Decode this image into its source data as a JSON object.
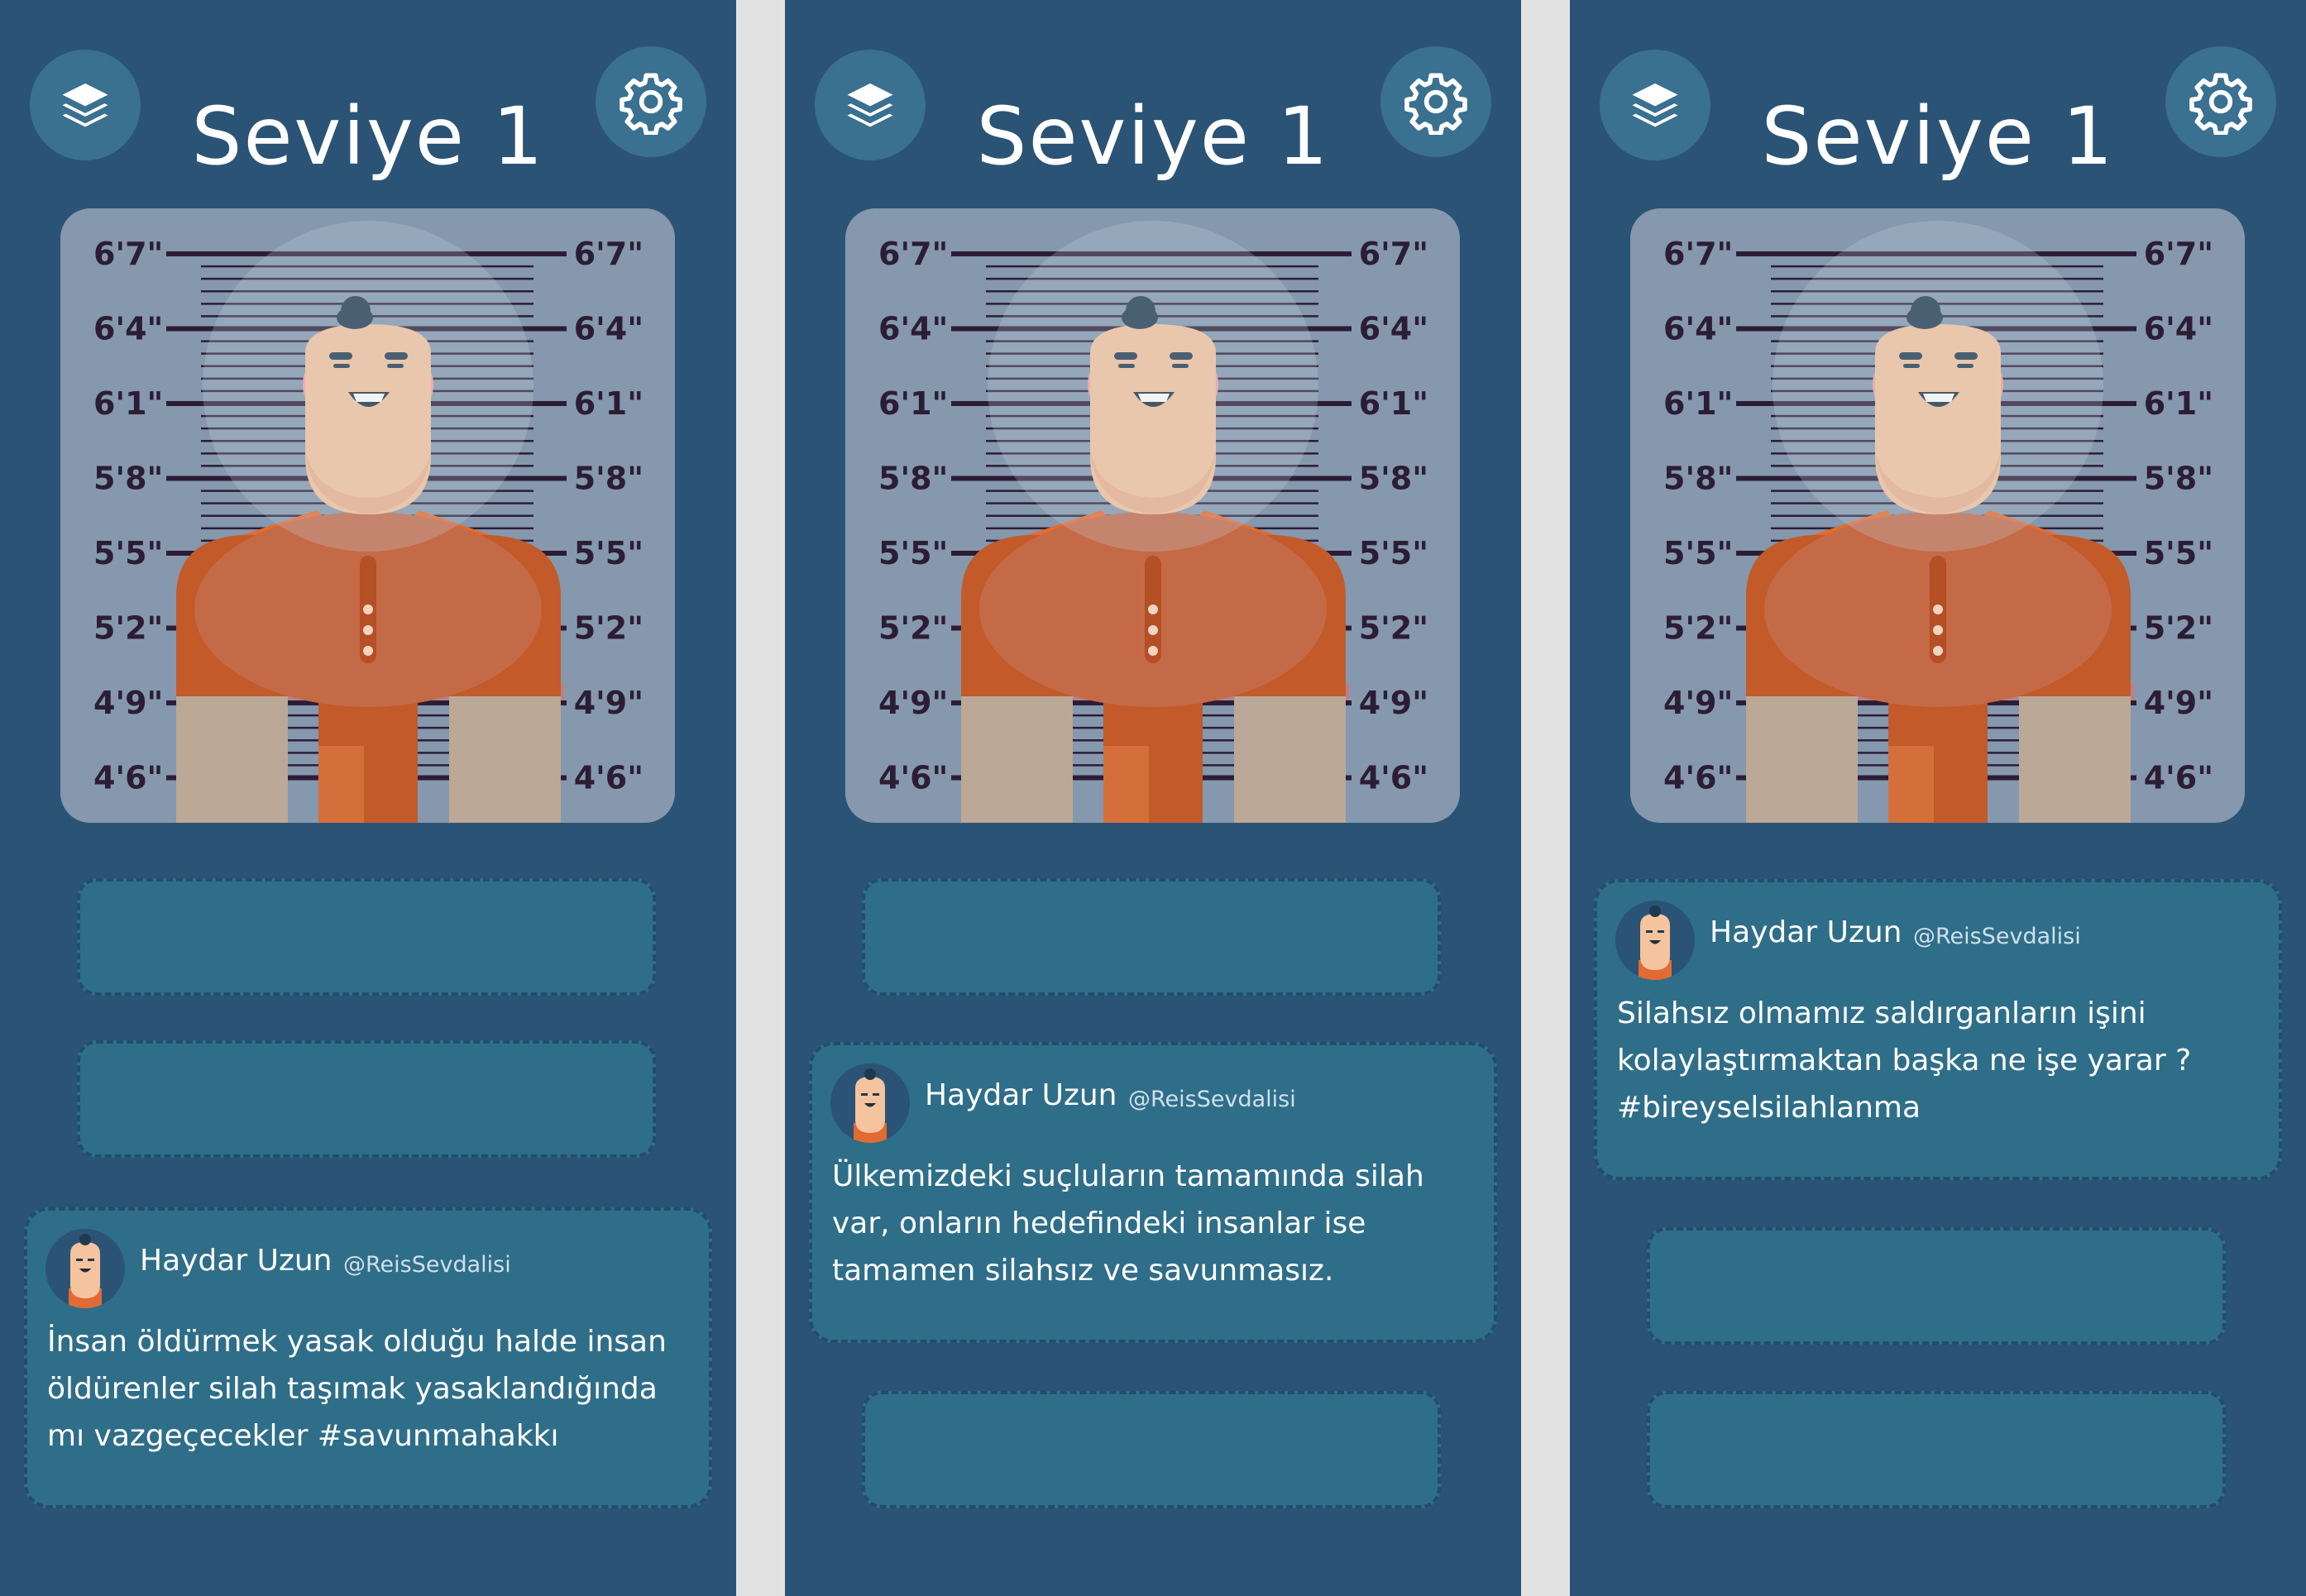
{
  "screens": [
    {
      "header": {
        "title": "Seviye 1",
        "left_icon": "layers-icon",
        "right_icon": "gear-icon"
      },
      "tweet": {
        "name": "Haydar Uzun",
        "handle": "@ReisSevdalisi",
        "text": "İnsan öldürmek yasak olduğu halde insan öldürenler silah taşımak yasaklandığında mı vazgeçecekler #savunmahakkı"
      }
    },
    {
      "header": {
        "title": "Seviye 1",
        "left_icon": "layers-icon",
        "right_icon": "gear-icon"
      },
      "tweet": {
        "name": "Haydar Uzun",
        "handle": "@ReisSevdalisi",
        "text": "Ülkemizdeki suçluların tamamında silah var, onların hedefindeki insanlar ise tamamen silahsız ve savunmasız."
      }
    },
    {
      "header": {
        "title": "Seviye 1",
        "left_icon": "layers-icon",
        "right_icon": "gear-icon"
      },
      "tweet": {
        "name": "Haydar Uzun",
        "handle": "@ReisSevdalisi",
        "text": "Silahsız olmamız saldırganların işini kolaylaştırmaktan başka ne işe yarar ? #bireyselsilahlanma"
      }
    }
  ],
  "height_chart": {
    "marks": [
      "6'7\"",
      "6'4\"",
      "6'1\"",
      "5'8\"",
      "5'5\"",
      "5'2\"",
      "4'9\"",
      "4'6\""
    ]
  },
  "colors": {
    "background": "#2b5375",
    "card": "#2f6e89",
    "card_border": "#214e6a",
    "icon_button": "#3a7090",
    "mugshot_bg": "#8598ae",
    "chart_text": "#2c1d35",
    "shirt": "#c25a2a",
    "skin": "#f5c39d"
  }
}
